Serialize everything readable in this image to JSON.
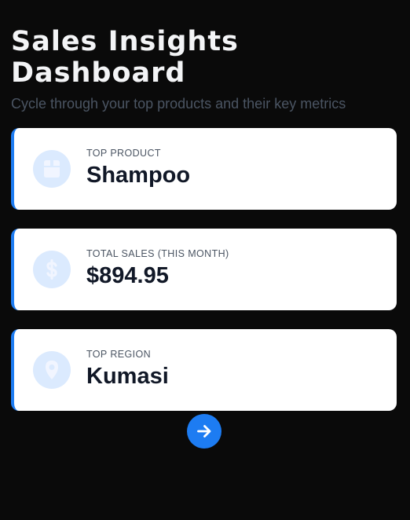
{
  "header": {
    "title": "Sales Insights\nDashboard",
    "subtitle": "Cycle through your top products and their key metrics"
  },
  "cards": [
    {
      "label": "TOP PRODUCT",
      "value": "Shampoo",
      "icon": "box-icon"
    },
    {
      "label": "TOTAL SALES (THIS MONTH)",
      "value": "$894.95",
      "icon": "dollar-icon"
    },
    {
      "label": "TOP REGION",
      "value": "Kumasi",
      "icon": "map-pin-icon"
    }
  ],
  "next_button": {
    "icon": "arrow-right-icon"
  },
  "colors": {
    "background": "#0a0a0a",
    "accent": "#1d7cf2",
    "icon_bg": "#dbeafe",
    "icon_fg": "#f1f5ff"
  }
}
